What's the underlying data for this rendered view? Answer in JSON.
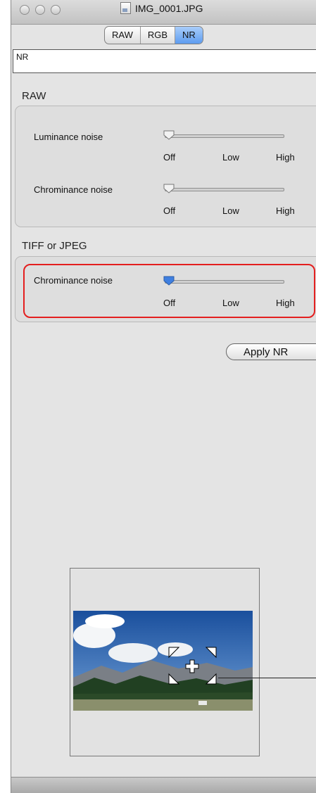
{
  "window": {
    "title": "IMG_0001.JPG"
  },
  "tabs": [
    {
      "label": "RAW",
      "active": false
    },
    {
      "label": "RGB",
      "active": false
    },
    {
      "label": "NR",
      "active": true
    }
  ],
  "settings_name": {
    "value": "NR"
  },
  "raw_section": {
    "label": "RAW",
    "rows": [
      {
        "label": "Luminance noise",
        "value": "Off",
        "ticks": [
          "Off",
          "Low",
          "High"
        ]
      },
      {
        "label": "Chrominance noise",
        "value": "Off",
        "ticks": [
          "Off",
          "Low",
          "High"
        ]
      }
    ]
  },
  "tiff_section": {
    "label": "TIFF or JPEG",
    "rows": [
      {
        "label": "Chrominance noise",
        "value": "Off",
        "ticks": [
          "Off",
          "Low",
          "High"
        ],
        "highlighted": true
      }
    ]
  },
  "apply_button": {
    "label": "Apply NR"
  },
  "navigator": {
    "icons": [
      "move-cross-icon",
      "crop-corner-icon"
    ]
  },
  "colors": {
    "accent_tab": "#5d9cf0",
    "highlight": "#e41f1f",
    "knob_active": "#3f7fe0"
  }
}
